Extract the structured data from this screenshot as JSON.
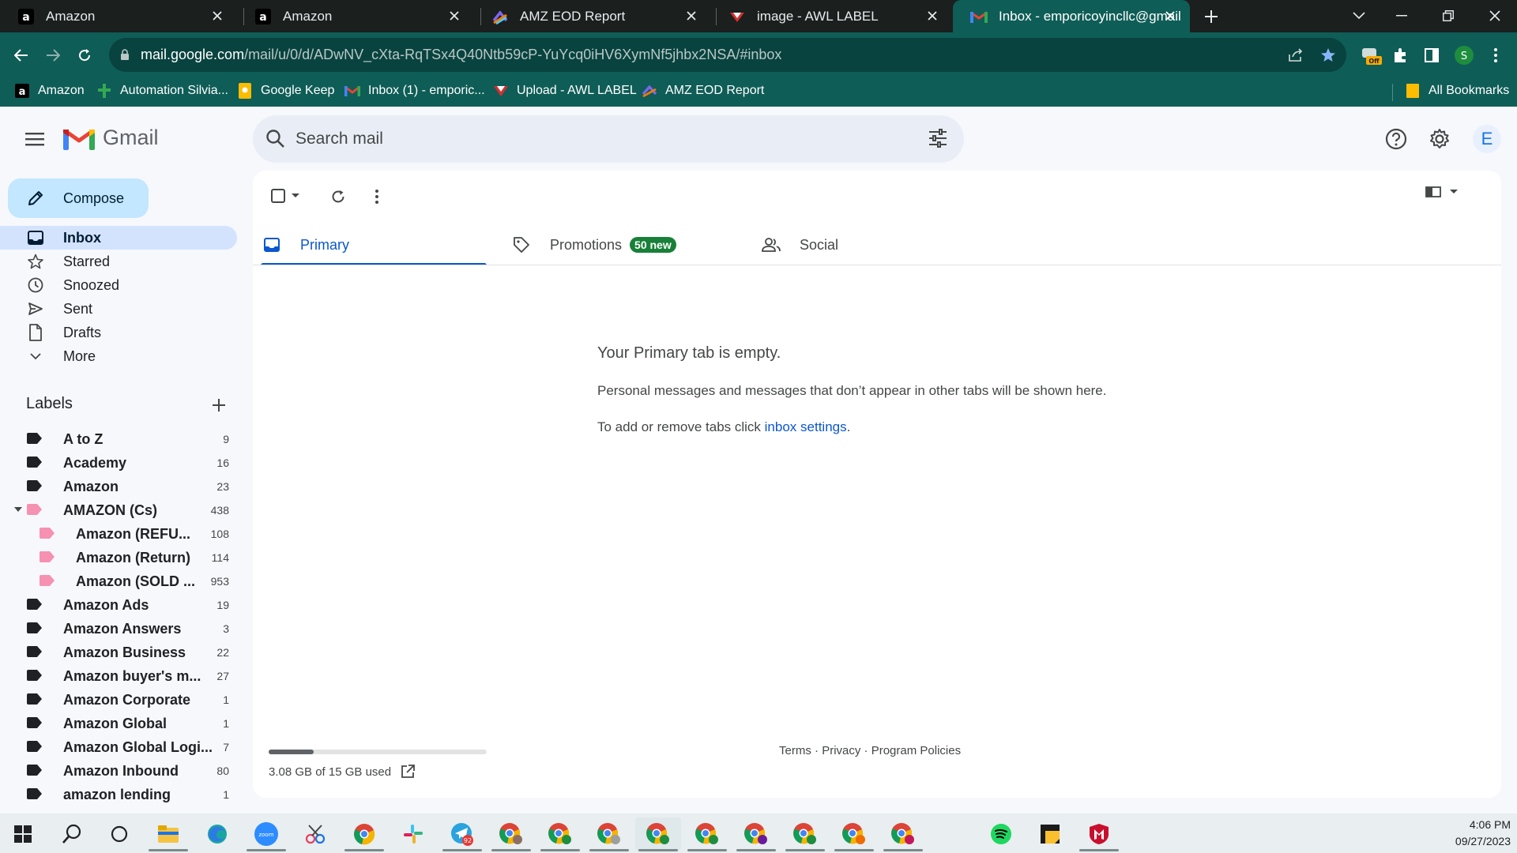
{
  "browser": {
    "tabs": [
      {
        "title": "Amazon",
        "icon": "amazon-icon"
      },
      {
        "title": "Amazon",
        "icon": "amazon-icon"
      },
      {
        "title": "AMZ EOD Report",
        "icon": "clickup-icon"
      },
      {
        "title": "image - AWL LABEL",
        "icon": "awl-icon"
      },
      {
        "title": "Inbox - emporicoyincllc@gmail.c",
        "icon": "gmail-icon",
        "active": true
      }
    ],
    "url_host": "mail.google.com",
    "url_path": "/mail/u/0/d/ADwNV_cXta-RqTSx4Q40Ntb59cP-YuYcq0iHV6XymNf5jhbx2NSA/#inbox",
    "profile_initial": "S",
    "bookmarks": [
      {
        "label": "Amazon",
        "icon": "amazon-icon"
      },
      {
        "label": "Automation Silvia...",
        "icon": "sheets-icon"
      },
      {
        "label": "Google Keep",
        "icon": "keep-icon"
      },
      {
        "label": "Inbox (1) - emporic...",
        "icon": "gmail-icon"
      },
      {
        "label": "Upload - AWL LABEL",
        "icon": "awl-icon"
      },
      {
        "label": "AMZ EOD Report",
        "icon": "clickup-icon"
      }
    ],
    "all_bookmarks": "All Bookmarks"
  },
  "gmail": {
    "logo_text": "Gmail",
    "search_placeholder": "Search mail",
    "avatar_initial": "E",
    "compose_label": "Compose",
    "nav": [
      {
        "label": "Inbox",
        "icon": "inbox-icon",
        "selected": true
      },
      {
        "label": "Starred",
        "icon": "star-icon"
      },
      {
        "label": "Snoozed",
        "icon": "clock-icon"
      },
      {
        "label": "Sent",
        "icon": "send-icon"
      },
      {
        "label": "Drafts",
        "icon": "draft-icon"
      },
      {
        "label": "More",
        "icon": "chevron-down-icon"
      }
    ],
    "labels_title": "Labels",
    "labels": [
      {
        "name": "A to Z",
        "count": "9"
      },
      {
        "name": "Academy",
        "count": "16"
      },
      {
        "name": "Amazon",
        "count": "23"
      },
      {
        "name": "AMAZON (Cs)",
        "count": "438",
        "color": "#f691b2",
        "expanded": true
      },
      {
        "name": "Amazon (REFU...",
        "count": "108",
        "color": "#f691b2",
        "child": true
      },
      {
        "name": "Amazon (Return)",
        "count": "114",
        "color": "#f691b2",
        "child": true
      },
      {
        "name": "Amazon (SOLD ...",
        "count": "953",
        "color": "#f691b2",
        "child": true
      },
      {
        "name": "Amazon Ads",
        "count": "19"
      },
      {
        "name": "Amazon Answers",
        "count": "3"
      },
      {
        "name": "Amazon Business",
        "count": "22"
      },
      {
        "name": "Amazon buyer's m...",
        "count": "27"
      },
      {
        "name": "Amazon Corporate",
        "count": "1"
      },
      {
        "name": "Amazon Global",
        "count": "1"
      },
      {
        "name": "Amazon Global Logi...",
        "count": "7"
      },
      {
        "name": "Amazon Inbound",
        "count": "80"
      },
      {
        "name": "amazon lending",
        "count": "1"
      }
    ],
    "inbox_tabs": [
      {
        "label": "Primary",
        "icon": "inbox-icon",
        "active": true
      },
      {
        "label": "Promotions",
        "icon": "tag-icon",
        "badge": "50 new"
      },
      {
        "label": "Social",
        "icon": "people-icon"
      }
    ],
    "empty_title": "Your Primary tab is empty.",
    "empty_desc": "Personal messages and messages that don’t appear in other tabs will be shown here.",
    "empty_hint_prefix": "To add or remove tabs click ",
    "empty_hint_link": "inbox settings",
    "empty_hint_suffix": ".",
    "storage_text": "3.08 GB of 15 GB used",
    "storage_fraction": 0.205,
    "footer": {
      "terms": "Terms",
      "sep1": " · ",
      "privacy": "Privacy",
      "sep2": " · ",
      "policies": "Program Policies"
    }
  },
  "taskbar": {
    "time": "4:06 PM",
    "date": "09/27/2023",
    "zoom_label": "zoom",
    "telegram_badge": "92"
  },
  "colors": {
    "brand": "#0f5d57",
    "accent": "#0b57d0",
    "badge": "#188038",
    "label_pink": "#f691b2"
  }
}
